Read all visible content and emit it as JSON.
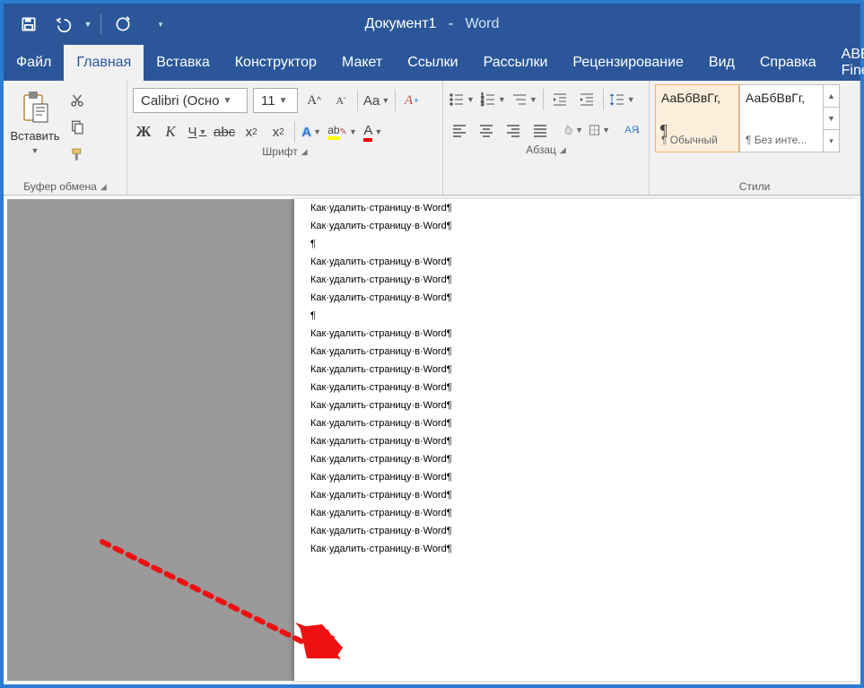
{
  "title": {
    "doc": "Документ1",
    "sep": "-",
    "app": "Word"
  },
  "tabs": [
    "Файл",
    "Главная",
    "Вставка",
    "Конструктор",
    "Макет",
    "Ссылки",
    "Рассылки",
    "Рецензирование",
    "Вид",
    "Справка",
    "ABBYY Finel"
  ],
  "active_tab_index": 1,
  "clipboard": {
    "paste": "Вставить",
    "group": "Буфер обмена"
  },
  "font": {
    "name": "Calibri (Осно",
    "size": "11",
    "group": "Шрифт",
    "bold": "Ж",
    "italic": "К",
    "under": "Ч",
    "strike": "abc",
    "sub": "x₂",
    "sup": "x²",
    "case": "Aa",
    "clear": "A",
    "outline": "A",
    "highlight": "ab",
    "color": "A"
  },
  "para": {
    "group": "Абзац",
    "sort": "А↓Я",
    "marks": "¶"
  },
  "styles": {
    "group": "Стили",
    "preview": "АаБбВвГг,",
    "items": [
      "¶ Обычный",
      "¶ Без инте..."
    ]
  },
  "doc_line": "Как·удалить·страницу·в·Word¶",
  "doc_blank": "¶",
  "doc_sequence": [
    0,
    0,
    1,
    0,
    0,
    0,
    1,
    0,
    0,
    0,
    0,
    0,
    0,
    0,
    0,
    0,
    0,
    0,
    0,
    0
  ]
}
